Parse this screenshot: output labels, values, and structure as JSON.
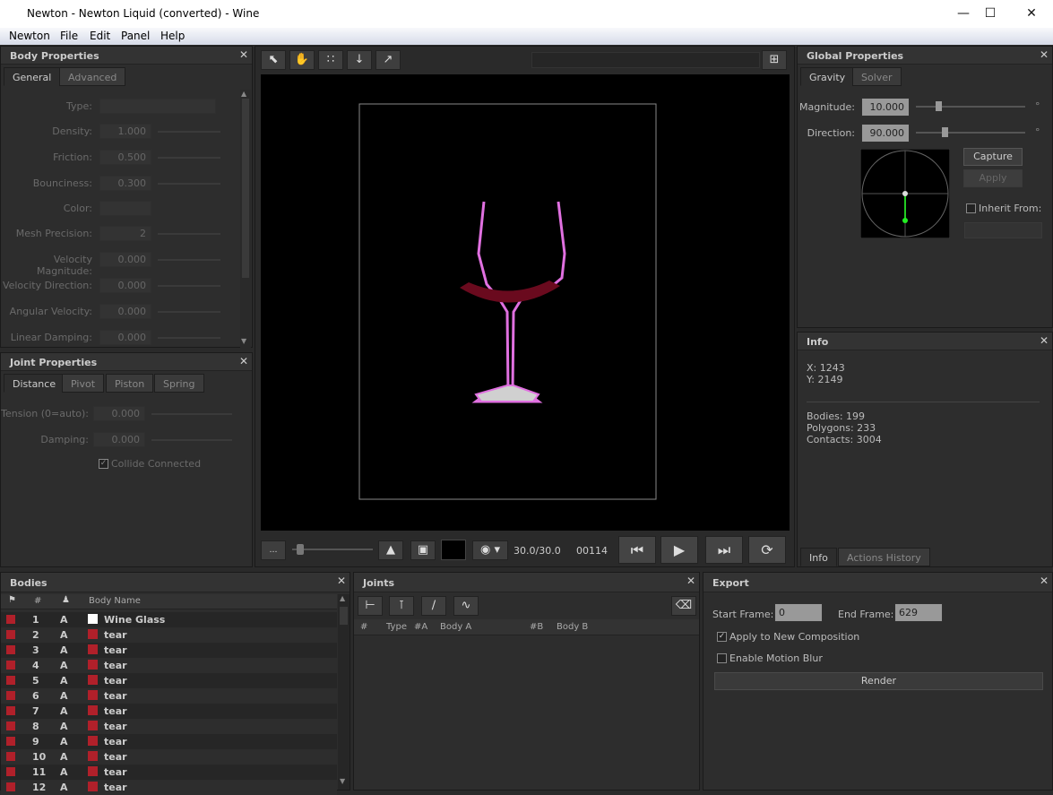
{
  "window": {
    "title": "Newton - Newton Liquid (converted) - Wine"
  },
  "menu": [
    "Newton",
    "File",
    "Edit",
    "Panel",
    "Help"
  ],
  "body_props": {
    "title": "Body Properties",
    "tabs": [
      "General",
      "Advanced"
    ],
    "fields": [
      {
        "label": "Type:",
        "value": ""
      },
      {
        "label": "Density:",
        "value": "1.000"
      },
      {
        "label": "Friction:",
        "value": "0.500"
      },
      {
        "label": "Bounciness:",
        "value": "0.300"
      },
      {
        "label": "Color:",
        "value": ""
      },
      {
        "label": "Mesh Precision:",
        "value": "2"
      },
      {
        "label": "Velocity Magnitude:",
        "value": "0.000"
      },
      {
        "label": "Velocity Direction:",
        "value": "0.000"
      },
      {
        "label": "Angular Velocity:",
        "value": "0.000"
      },
      {
        "label": "Linear Damping:",
        "value": "0.000"
      }
    ]
  },
  "joint_props": {
    "title": "Joint Properties",
    "tabs": [
      "Distance",
      "Pivot",
      "Piston",
      "Spring"
    ],
    "fields": [
      {
        "label": "Tension (0=auto):",
        "value": "0.000"
      },
      {
        "label": "Damping:",
        "value": "0.000"
      }
    ],
    "collide": "Collide Connected"
  },
  "viewer": {
    "time": "30.0/30.0",
    "frame": "00114",
    "slider_fraction": 0.05
  },
  "global": {
    "title": "Global Properties",
    "tabs": [
      "Gravity",
      "Solver"
    ],
    "magnitude_label": "Magnitude:",
    "magnitude": "10.000",
    "direction_label": "Direction:",
    "direction": "90.000",
    "capture": "Capture",
    "apply": "Apply",
    "inherit": "Inherit From:"
  },
  "info": {
    "title": "Info",
    "x": "X: 1243",
    "y": "Y: 2149",
    "bodies": "Bodies: 199",
    "polygons": "Polygons: 233",
    "contacts": "Contacts: 3004",
    "tabs": [
      "Info",
      "Actions History"
    ]
  },
  "bodies": {
    "title": "Bodies",
    "headers": [
      "#",
      "Body Name"
    ],
    "rows": [
      {
        "n": "1",
        "t": "A",
        "name": "Wine Glass",
        "color": "#ffffff"
      },
      {
        "n": "2",
        "t": "A",
        "name": "tear",
        "color": "#b0202a"
      },
      {
        "n": "3",
        "t": "A",
        "name": "tear",
        "color": "#b0202a"
      },
      {
        "n": "4",
        "t": "A",
        "name": "tear",
        "color": "#b0202a"
      },
      {
        "n": "5",
        "t": "A",
        "name": "tear",
        "color": "#b0202a"
      },
      {
        "n": "6",
        "t": "A",
        "name": "tear",
        "color": "#b0202a"
      },
      {
        "n": "7",
        "t": "A",
        "name": "tear",
        "color": "#b0202a"
      },
      {
        "n": "8",
        "t": "A",
        "name": "tear",
        "color": "#b0202a"
      },
      {
        "n": "9",
        "t": "A",
        "name": "tear",
        "color": "#b0202a"
      },
      {
        "n": "10",
        "t": "A",
        "name": "tear",
        "color": "#b0202a"
      },
      {
        "n": "11",
        "t": "A",
        "name": "tear",
        "color": "#b0202a"
      },
      {
        "n": "12",
        "t": "A",
        "name": "tear",
        "color": "#b0202a"
      }
    ]
  },
  "joints": {
    "title": "Joints",
    "headers": [
      "#",
      "Type",
      "#A",
      "Body A",
      "#B",
      "Body B"
    ]
  },
  "export": {
    "title": "Export",
    "start_label": "Start Frame:",
    "start": "0",
    "end_label": "End Frame:",
    "end": "629",
    "apply_comp": "Apply to New Composition",
    "motion_blur": "Enable Motion Blur",
    "render": "Render"
  }
}
